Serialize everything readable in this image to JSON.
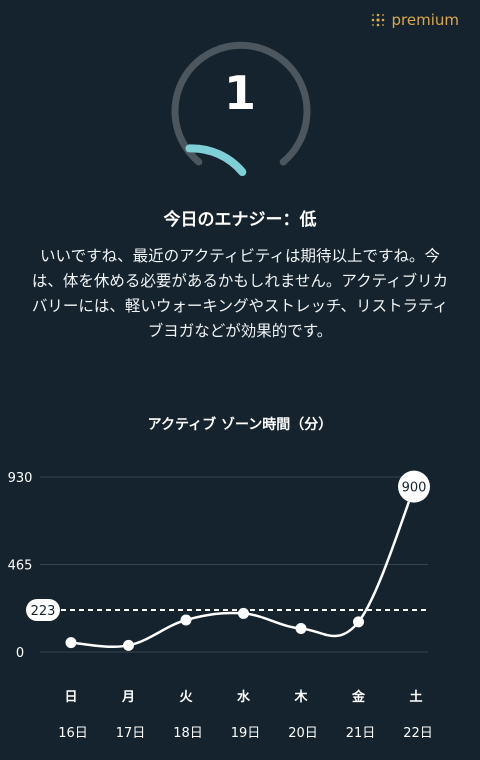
{
  "header": {
    "premium_label": "premium",
    "premium_icon": "dotted-grid-icon",
    "accent_color": "#d9a94a"
  },
  "energy": {
    "score": "1",
    "score_fraction": 0.2,
    "gauge_color": "#7fcfd6",
    "track_color": "#4b565e",
    "title": "今日のエナジー：低",
    "description": "いいですね、最近のアクティビティは期待以上ですね。今は、体を休める必要があるかもしれません。アクティブリカバリーには、軽いウォーキングやストレッチ、リストラティブヨガなどが効果的です。"
  },
  "chart_title": "アクティブ ゾーン時間（分）",
  "chart_data": {
    "type": "line",
    "title": "アクティブ ゾーン時間（分）",
    "categories": [
      "日",
      "月",
      "火",
      "水",
      "木",
      "金",
      "土"
    ],
    "dates": [
      "16日",
      "17日",
      "18日",
      "19日",
      "20日",
      "21日",
      "22日"
    ],
    "values": [
      50,
      35,
      170,
      205,
      125,
      160,
      900
    ],
    "yticks": [
      "930",
      "465",
      "0"
    ],
    "ylim": [
      0,
      930
    ],
    "reference_line": {
      "value": 223,
      "label": "223"
    },
    "highlight_label": "900",
    "grid": true,
    "line_color": "#ffffff"
  }
}
